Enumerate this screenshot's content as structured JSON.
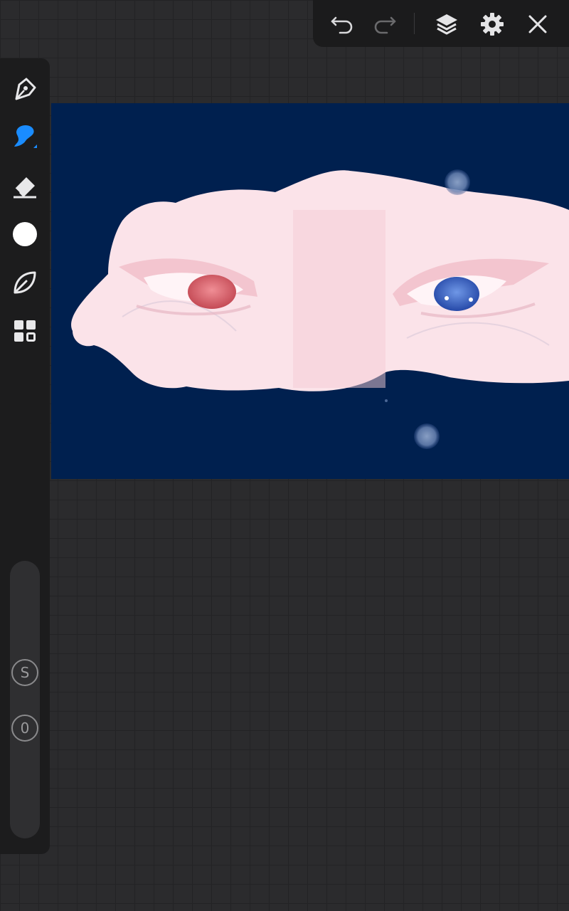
{
  "app": {
    "toolbar": {
      "undo_icon": "undo-icon",
      "redo_icon": "redo-icon",
      "layers_icon": "layers-icon",
      "settings_icon": "gear-icon",
      "close_icon": "close-icon"
    },
    "sidebar": {
      "tools": [
        "pen-tool-icon",
        "brush-tool-icon",
        "eraser-icon",
        "color-icon",
        "leaf-icon",
        "grid-menu-icon"
      ],
      "active_tool": "brush-tool-icon",
      "selected_color": "#ffffff",
      "size_button_label": "S",
      "opacity_button_label": "0"
    },
    "canvas": {
      "background_color": "#00204f",
      "accent_color": "#1a8cff"
    }
  }
}
